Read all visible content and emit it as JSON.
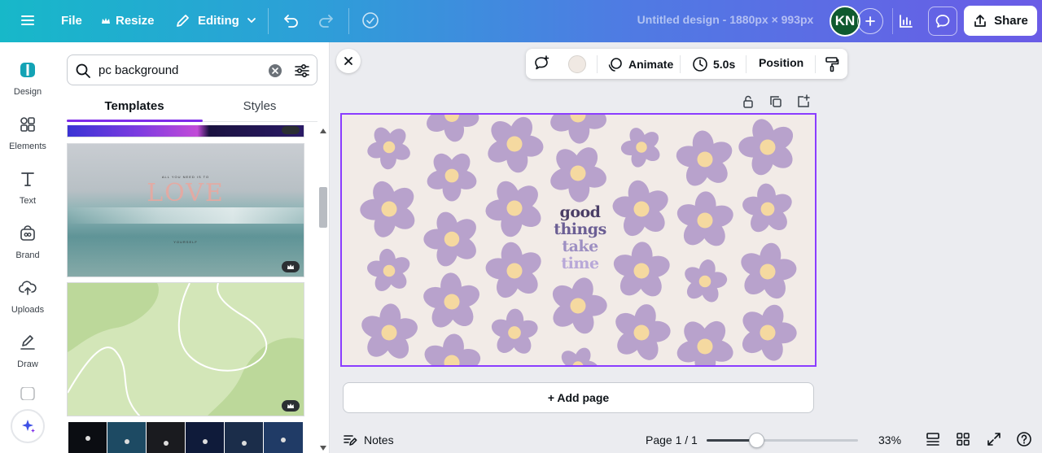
{
  "topbar": {
    "menu_icon": "hamburger-icon",
    "file_label": "File",
    "resize_label": "Resize",
    "editing_label": "Editing",
    "doc_title": "Untitled design - 1880px × 993px",
    "avatar_initials": "KN",
    "share_label": "Share"
  },
  "rail": {
    "items": [
      {
        "label": "Design",
        "icon": "design-icon"
      },
      {
        "label": "Elements",
        "icon": "elements-icon"
      },
      {
        "label": "Text",
        "icon": "text-icon"
      },
      {
        "label": "Brand",
        "icon": "brand-icon"
      },
      {
        "label": "Uploads",
        "icon": "uploads-icon"
      },
      {
        "label": "Draw",
        "icon": "draw-icon"
      }
    ]
  },
  "panel": {
    "search_value": "pc background",
    "tabs": [
      "Templates",
      "Styles"
    ],
    "active_tab": "Templates",
    "thumb_ocean_small_text": "ALL YOU NEED IS TO",
    "thumb_ocean_big_text": "LOVE",
    "thumb_ocean_footer_text": "YOURSELF"
  },
  "context_toolbar": {
    "animate_label": "Animate",
    "duration_label": "5.0s",
    "position_label": "Position",
    "bg_color": "#f0e9e3"
  },
  "canvas": {
    "bg_color": "#f2ebe7",
    "flower_color": "#b8a2cc",
    "center_color": "#f5d9a0",
    "text_lines": [
      "good",
      "things",
      "take",
      "time"
    ]
  },
  "add_page_label": "+ Add page",
  "bottombar": {
    "notes_label": "Notes",
    "page_label": "Page 1 / 1",
    "zoom_label": "33%",
    "zoom_level": 0.33
  }
}
